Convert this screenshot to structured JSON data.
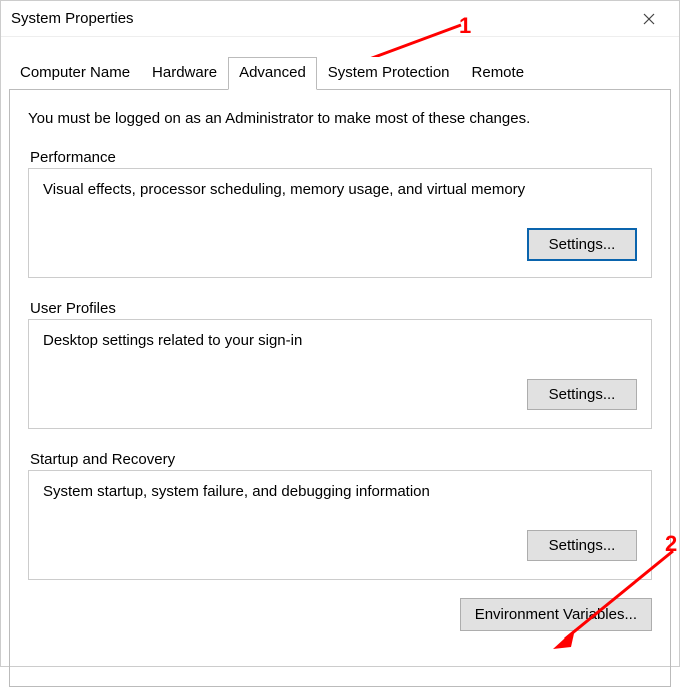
{
  "window": {
    "title": "System Properties"
  },
  "tabs": {
    "computer_name": "Computer Name",
    "hardware": "Hardware",
    "advanced": "Advanced",
    "system_protection": "System Protection",
    "remote": "Remote"
  },
  "intro": "You must be logged on as an Administrator to make most of these changes.",
  "performance": {
    "label": "Performance",
    "desc": "Visual effects, processor scheduling, memory usage, and virtual memory",
    "settings": "Settings..."
  },
  "user_profiles": {
    "label": "User Profiles",
    "desc": "Desktop settings related to your sign-in",
    "settings": "Settings..."
  },
  "startup": {
    "label": "Startup and Recovery",
    "desc": "System startup, system failure, and debugging information",
    "settings": "Settings..."
  },
  "env_button": "Environment Variables...",
  "annotations": {
    "num1": "1",
    "num2": "2"
  }
}
